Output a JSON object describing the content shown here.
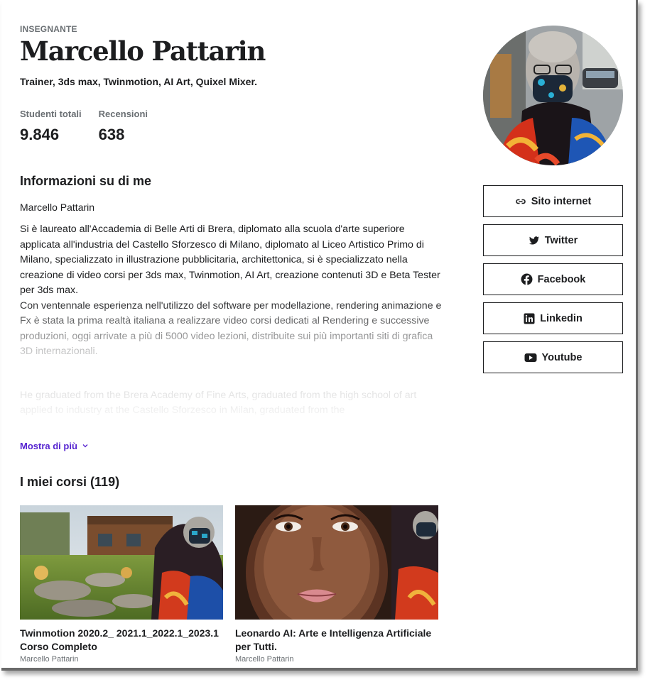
{
  "instructor": {
    "eyebrow": "INSEGNANTE",
    "name": "Marcello Pattarin",
    "headline": "Trainer, 3ds max, Twinmotion, AI Art, Quixel Mixer."
  },
  "stats": [
    {
      "label": "Studenti totali",
      "value": "9.846"
    },
    {
      "label": "Recensioni",
      "value": "638"
    }
  ],
  "about": {
    "title": "Informazioni su di me",
    "name_line": "Marcello Pattarin",
    "bio_it_1": "Si è laureato all'Accademia di Belle Arti di Brera, diplomato alla scuola d'arte superiore applicata all'industria del Castello Sforzesco di Milano, diplomato al Liceo Artistico Primo di Milano, specializzato in illustrazione pubblicitaria, architettonica, si è specializzato nella creazione di video corsi per 3ds max, Twinmotion, AI Art, creazione contenuti 3D e Beta Tester per 3ds max.",
    "bio_it_2": "Con ventennale esperienza nell'utilizzo del software per modellazione, rendering animazione e Fx è stata la prima realtà italiana a realizzare video corsi dedicati al Rendering e successive produzioni, oggi arrivate a più di 5000 video lezioni, distribuite sui più importanti siti di grafica 3D internazionali.",
    "bio_en": "He graduated from the Brera Academy of Fine Arts, graduated from the high school of art applied to industry at the Castello Sforzesco in Milan, graduated from the",
    "show_more": "Mostra di più"
  },
  "courses": {
    "title": "I miei corsi (119)",
    "items": [
      {
        "title": "Twinmotion 2020.2_ 2021.1_2022.1_2023.1 Corso Completo",
        "author": "Marcello Pattarin"
      },
      {
        "title": "Leonardo AI: Arte e Intelligenza Artificiale per Tutti.",
        "author": "Marcello Pattarin"
      }
    ]
  },
  "links": [
    {
      "label": "Sito internet",
      "icon": "link-icon"
    },
    {
      "label": "Twitter",
      "icon": "twitter-icon"
    },
    {
      "label": "Facebook",
      "icon": "facebook-icon"
    },
    {
      "label": "Linkedin",
      "icon": "linkedin-icon"
    },
    {
      "label": "Youtube",
      "icon": "youtube-icon"
    }
  ],
  "colors": {
    "accent": "#5624d0",
    "text": "#1c1d1f",
    "muted": "#6a6f73"
  }
}
